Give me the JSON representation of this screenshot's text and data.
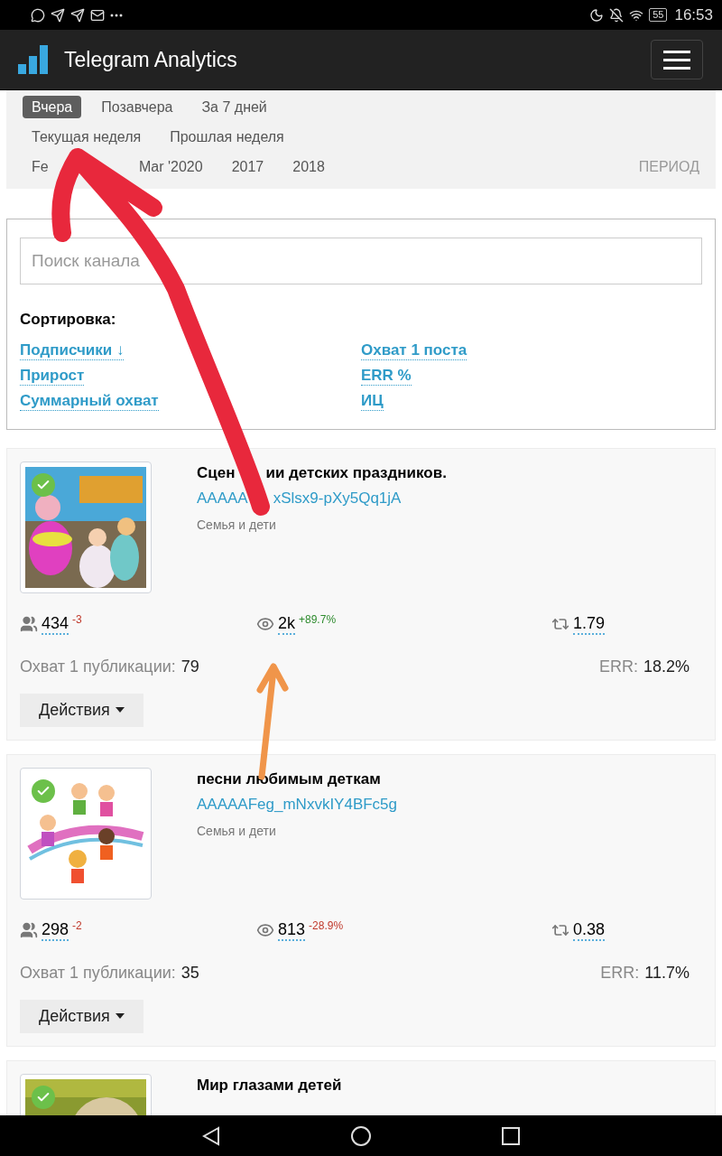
{
  "status_bar": {
    "battery": "55",
    "time": "16:53"
  },
  "header": {
    "title": "Telegram Analytics"
  },
  "periods": {
    "rows": [
      [
        {
          "label": "Вчера",
          "selected": true
        },
        {
          "label": "Позавчера",
          "selected": false
        },
        {
          "label": "За 7 дней",
          "selected": false
        }
      ],
      [
        {
          "label": "Текущая неделя",
          "selected": false
        },
        {
          "label": "Прошлая неделя",
          "selected": false
        }
      ],
      [
        {
          "label": "Fe",
          "selected": false
        },
        {
          "label": "Mar '2020",
          "selected": false
        },
        {
          "label": "2017",
          "selected": false
        },
        {
          "label": "2018",
          "selected": false
        }
      ]
    ],
    "period_link": "ПЕРИОД"
  },
  "search": {
    "placeholder": "Поиск канала",
    "sort_title": "Сортировка:",
    "sort_columns": [
      [
        "Подписчики ↓",
        "Прирост",
        "Суммарный охват"
      ],
      [
        "Охват 1 поста",
        "ERR %",
        "ИЦ"
      ]
    ]
  },
  "channels": [
    {
      "title_parts": [
        "Сцен",
        "ии детских праздников."
      ],
      "link_parts": [
        "AAAAA",
        "xSlsx9-pXy5Qq1jA"
      ],
      "category": "Семья и дети",
      "verified": true,
      "subscribers": "434",
      "subscribers_change": {
        "text": "-3",
        "color": "#c0392b"
      },
      "views": "2k",
      "views_change": {
        "text": "+89.7%",
        "color": "#2e8b2e"
      },
      "citation": "1.79",
      "reach_label": "Охват 1 публикации:",
      "reach": "79",
      "err_label": "ERR:",
      "err": "18.2%",
      "actions": "Действия"
    },
    {
      "title_parts": [
        "песни любимым деткам"
      ],
      "link_parts": [
        "AAAAAFeg_mNxvkIY4BFc5g"
      ],
      "category": "Семья и дети",
      "verified": true,
      "subscribers": "298",
      "subscribers_change": {
        "text": "-2",
        "color": "#c0392b"
      },
      "views": "813",
      "views_change": {
        "text": "-28.9%",
        "color": "#c0392b"
      },
      "citation": "0.38",
      "reach_label": "Охват 1 публикации:",
      "reach": "35",
      "err_label": "ERR:",
      "err": "11.7%",
      "actions": "Действия"
    },
    {
      "title_parts": [
        "Мир глазами детей"
      ],
      "verified": true
    }
  ]
}
